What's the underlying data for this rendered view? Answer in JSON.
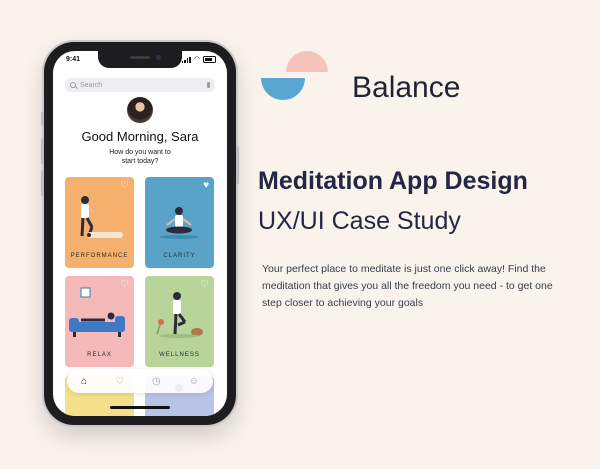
{
  "app": {
    "status_time": "9:41",
    "search_placeholder": "Search",
    "greeting": "Good Morning, Sara",
    "prompt": "How do you want to start today?",
    "cards": [
      {
        "label": "PERFORMANCE",
        "color": "#f6b06e"
      },
      {
        "label": "CLARITY",
        "color": "#5aa3c8"
      },
      {
        "label": "RELAX",
        "color": "#f5b9b9"
      },
      {
        "label": "WELLNESS",
        "color": "#b9d49a"
      }
    ],
    "tabs": [
      {
        "icon": "home-icon",
        "active": true
      },
      {
        "icon": "heart-icon",
        "active": false
      },
      {
        "icon": "clock-icon",
        "active": false
      },
      {
        "icon": "profile-icon",
        "active": false
      }
    ]
  },
  "brand": {
    "name": "Balance",
    "logo_colors": {
      "top": "#f7c2bc",
      "bottom": "#57a7d0"
    }
  },
  "headline": "Meditation App Design",
  "subheadline": "UX/UI Case Study",
  "description": "Your perfect place to meditate is just one click away! Find the meditation that gives you all the freedom you need - to get one step closer to achieving your goals"
}
